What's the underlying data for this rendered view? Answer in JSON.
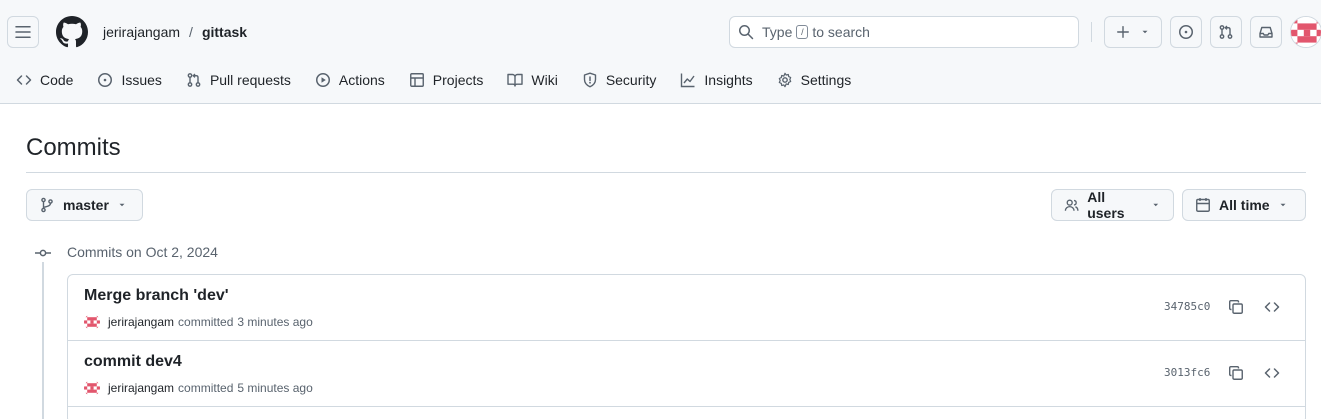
{
  "header": {
    "owner": "jerirajangam",
    "separator": "/",
    "repo": "gittask",
    "search": {
      "prefix": "Type",
      "key": "/",
      "suffix": "to search"
    }
  },
  "repo_nav": [
    {
      "label": "Code",
      "icon": "code-icon"
    },
    {
      "label": "Issues",
      "icon": "issue-opened-icon"
    },
    {
      "label": "Pull requests",
      "icon": "git-pull-request-icon"
    },
    {
      "label": "Actions",
      "icon": "play-icon"
    },
    {
      "label": "Projects",
      "icon": "table-icon"
    },
    {
      "label": "Wiki",
      "icon": "book-icon"
    },
    {
      "label": "Security",
      "icon": "shield-icon"
    },
    {
      "label": "Insights",
      "icon": "graph-icon"
    },
    {
      "label": "Settings",
      "icon": "gear-icon"
    }
  ],
  "page": {
    "title": "Commits",
    "branch": "master",
    "users_filter": "All users",
    "time_filter": "All time"
  },
  "groups": [
    {
      "label": "Commits on Oct 2, 2024",
      "commits": [
        {
          "title": "Merge branch 'dev'",
          "author": "jerirajangam",
          "action": "committed",
          "time": "3 minutes ago",
          "sha": "34785c0"
        },
        {
          "title": "commit dev4",
          "author": "jerirajangam",
          "action": "committed",
          "time": "5 minutes ago",
          "sha": "3013fc6"
        }
      ]
    }
  ],
  "colors": {
    "header_bg": "#f6f8fa",
    "border": "#d1d9e0",
    "text": "#1f2328",
    "muted": "#59636e",
    "avatar_pink": "#e2566d"
  }
}
